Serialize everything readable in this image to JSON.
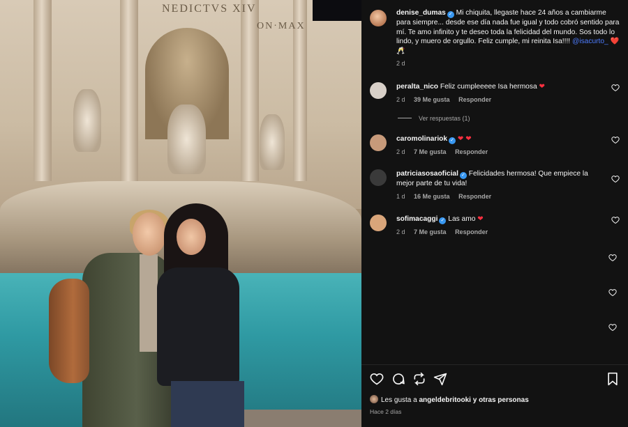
{
  "photo": {
    "inscription": "NEDICTVS XIV",
    "inscription2": "ON·MAX",
    "alt": "Two women hugging in front of the Trevi Fountain at night"
  },
  "caption": {
    "username": "denise_dumas",
    "text": "Mi chiquita, llegaste hace 24 años a cambiarme para siempre... desde ese día nada fue igual y todo cobró sentido para mí. Te amo infinito y te deseo toda la felicidad del mundo. Sos todo lo lindo, y muero de orgullo. Feliz cumple, mi reinita Isa!!!!",
    "mention": "@isacurto_",
    "emojis": "❤️ 🥂",
    "time": "2 d"
  },
  "comments": [
    {
      "username": "peralta_nico",
      "verified": false,
      "text": "Feliz cumpleeeee Isa hermosa",
      "emoji": "❤",
      "time": "2 d",
      "likes": "39 Me gusta",
      "reply": "Responder",
      "avatar_color": "#d8d0c8"
    },
    {
      "username": "caromolinariok",
      "verified": true,
      "text": "",
      "emoji": "❤ ❤",
      "time": "2 d",
      "likes": "7 Me gusta",
      "reply": "Responder",
      "avatar_color": "#c79a7a"
    },
    {
      "username": "patriciasosaoficial",
      "verified": true,
      "text": "Felicidades hermosa! Que empiece la mejor parte de tu vida!",
      "emoji": "",
      "time": "1 d",
      "likes": "16 Me gusta",
      "reply": "Responder",
      "avatar_color": "#3a3a3a"
    },
    {
      "username": "sofimacaggi",
      "verified": true,
      "text": "Las amo",
      "emoji": "❤",
      "time": "2 d",
      "likes": "7 Me gusta",
      "reply": "Responder",
      "avatar_color": "#d9a57a"
    }
  ],
  "replies_toggle": "Ver respuestas (1)",
  "footer": {
    "liked_by_prefix": "Les gusta a",
    "liked_by_user": "angeldebritooki",
    "liked_by_suffix": "y",
    "liked_by_others": "otras personas",
    "post_time": "Hace 2 días"
  },
  "icons": [
    "heart-outline-icon",
    "comment-icon",
    "repost-icon",
    "share-icon",
    "bookmark-icon"
  ],
  "colors": {
    "background": "#121212",
    "verified": "#3897f0",
    "heart": "#ff3040",
    "mention": "#4d7cff",
    "muted": "#a8a8a8"
  }
}
